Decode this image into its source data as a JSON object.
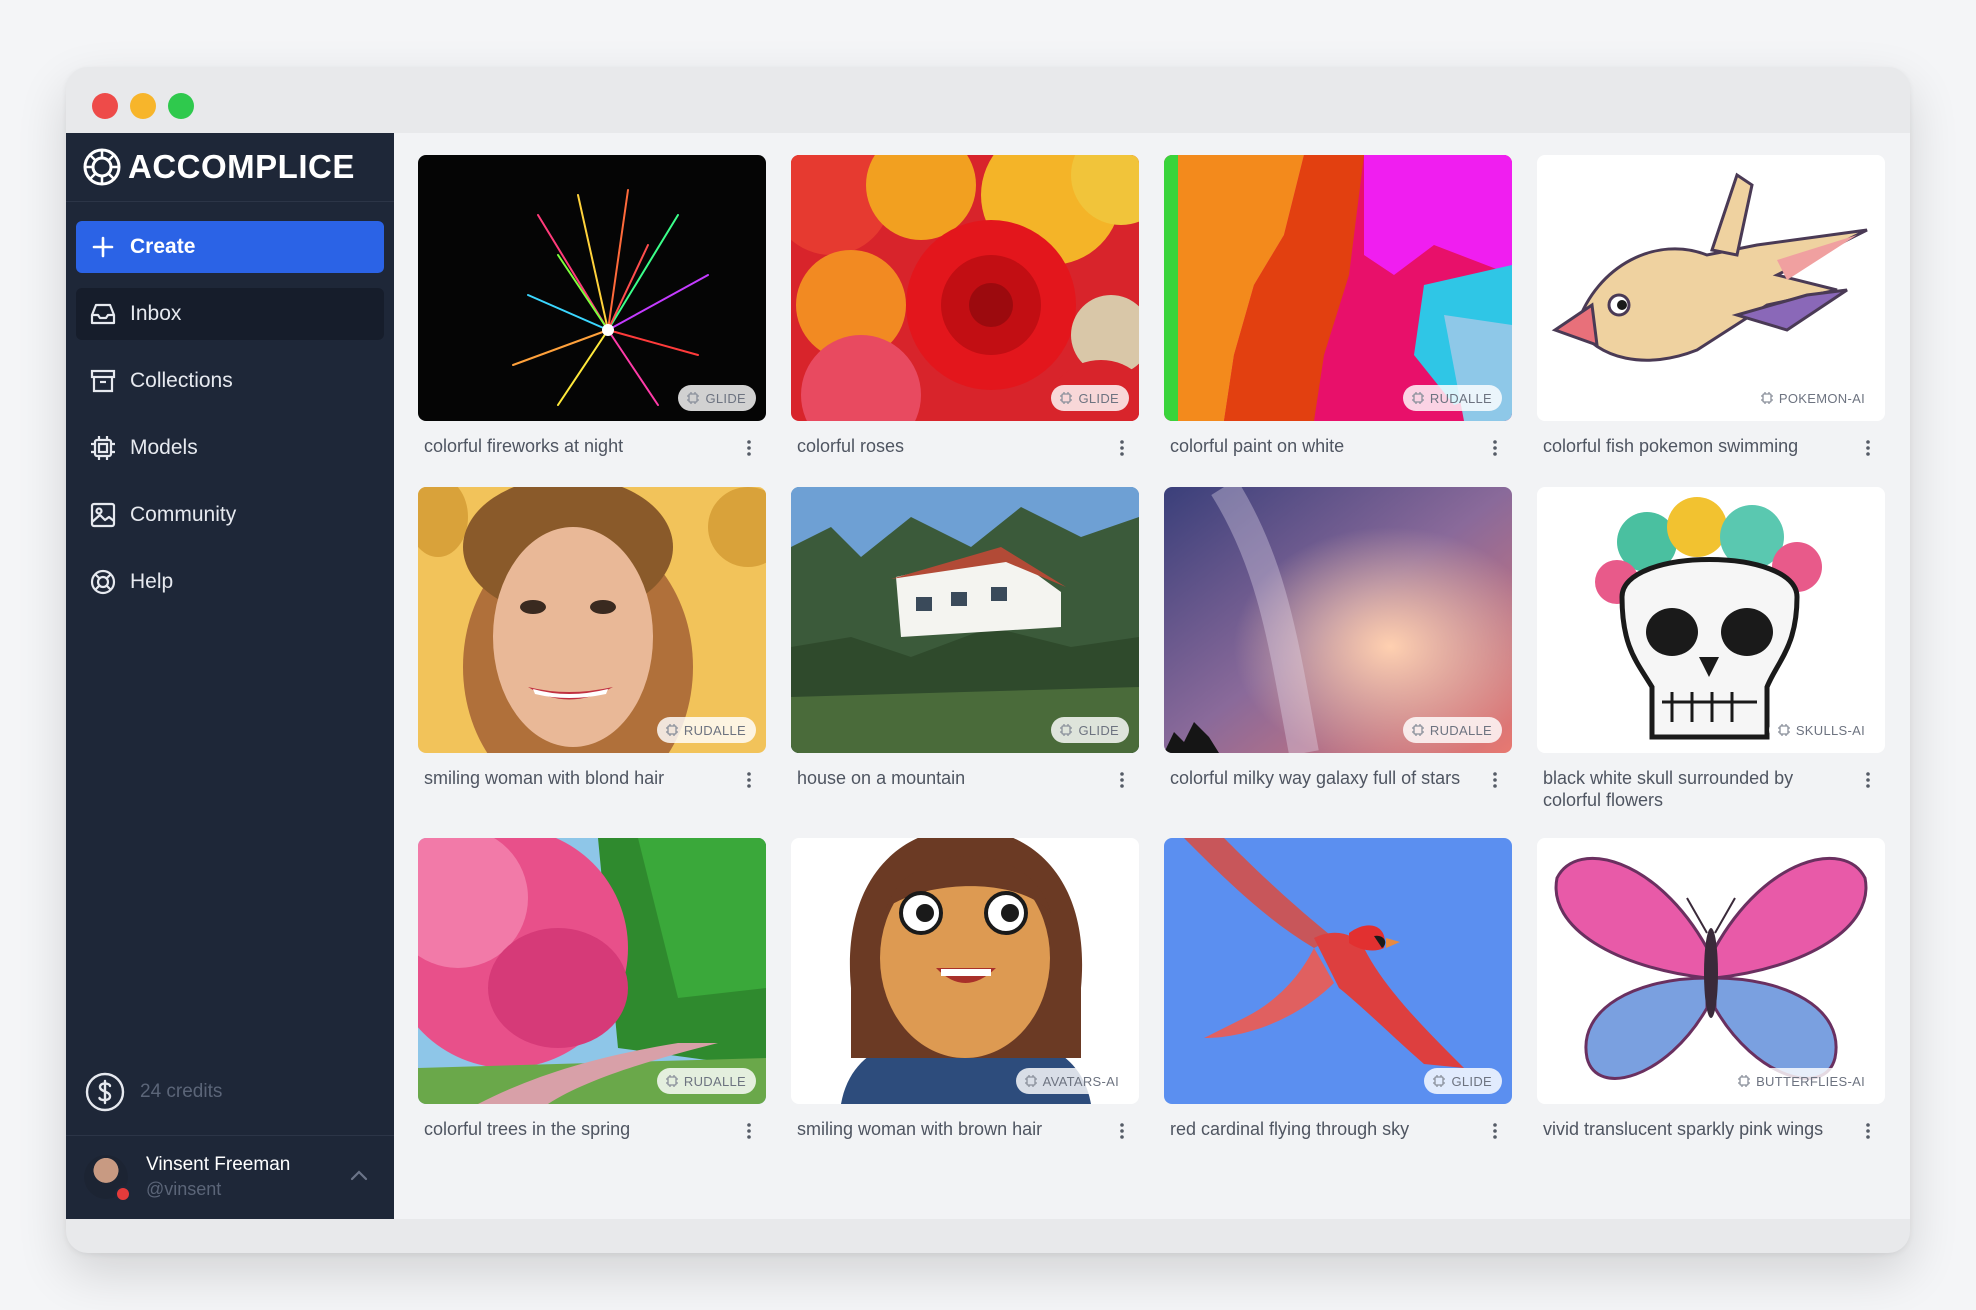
{
  "brand": {
    "name": "ACCOMPLICE"
  },
  "nav": [
    {
      "label": "Create",
      "icon": "plus-icon"
    },
    {
      "label": "Inbox",
      "icon": "inbox-icon"
    },
    {
      "label": "Collections",
      "icon": "archive-icon"
    },
    {
      "label": "Models",
      "icon": "chip-icon"
    },
    {
      "label": "Community",
      "icon": "image-icon"
    },
    {
      "label": "Help",
      "icon": "lifebuoy-icon"
    }
  ],
  "credits": {
    "label": "24 credits",
    "icon": "dollar-icon"
  },
  "user": {
    "name": "Vinsent Freeman",
    "handle": "@vinsent"
  },
  "cards": [
    {
      "caption": "colorful fireworks at night",
      "model": "GLIDE"
    },
    {
      "caption": "colorful roses",
      "model": "GLIDE"
    },
    {
      "caption": "colorful paint on white",
      "model": "RUDALLE"
    },
    {
      "caption": "colorful fish pokemon swimming",
      "model": "POKEMON-AI"
    },
    {
      "caption": "smiling woman with blond hair",
      "model": "RUDALLE"
    },
    {
      "caption": "house on a mountain",
      "model": "GLIDE"
    },
    {
      "caption": "colorful milky way galaxy full of stars",
      "model": "RUDALLE"
    },
    {
      "caption": "black white skull surrounded by colorful flowers",
      "model": "SKULLS-AI"
    },
    {
      "caption": "colorful trees in the spring",
      "model": "RUDALLE"
    },
    {
      "caption": "smiling woman with brown hair",
      "model": "AVATARS-AI"
    },
    {
      "caption": "red cardinal flying through sky",
      "model": "GLIDE"
    },
    {
      "caption": "vivid translucent sparkly pink wings",
      "model": "BUTTERFLIES-AI"
    }
  ],
  "colors": {
    "sidebar": "#1e2738",
    "accent": "#2b63e6",
    "active": "#161d2b"
  }
}
